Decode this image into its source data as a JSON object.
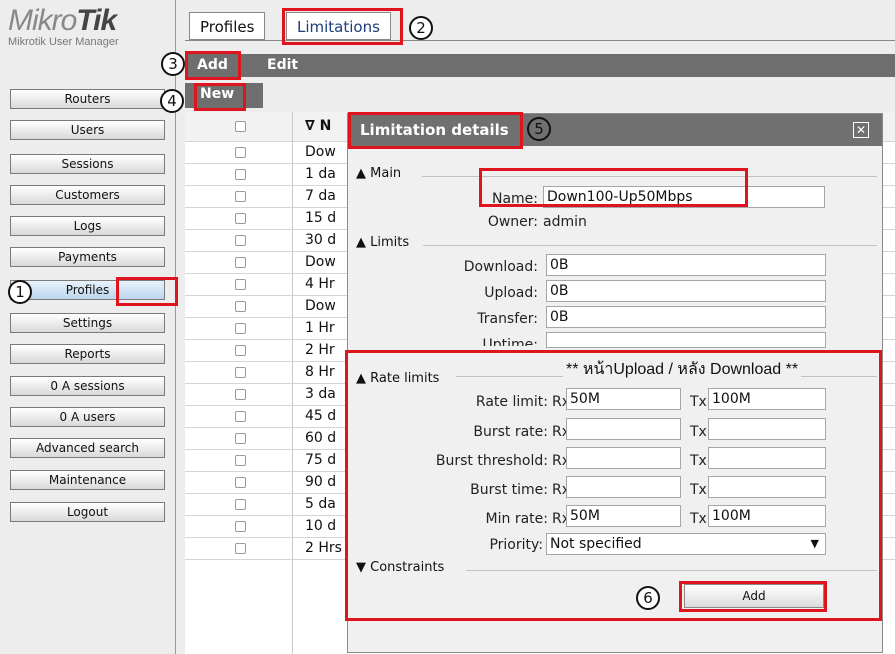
{
  "app": {
    "logo_brand_light": "Mikro",
    "logo_brand_bold": "Tik",
    "logo_sub": "Mikrotik User Manager"
  },
  "sidebar": {
    "items": [
      {
        "label": "Routers"
      },
      {
        "label": "Users"
      },
      {
        "label": "Sessions"
      },
      {
        "label": "Customers"
      },
      {
        "label": "Logs"
      },
      {
        "label": "Payments"
      },
      {
        "label": "Profiles"
      },
      {
        "label": "Settings"
      },
      {
        "label": "Reports"
      },
      {
        "label": "0 A sessions"
      },
      {
        "label": "0 A users"
      },
      {
        "label": "Advanced search"
      },
      {
        "label": "Maintenance"
      },
      {
        "label": "Logout"
      }
    ]
  },
  "tabs": [
    {
      "label": "Profiles"
    },
    {
      "label": "Limitations"
    }
  ],
  "toolbar": {
    "add_label": "Add",
    "edit_label": "Edit",
    "new_label": "New"
  },
  "table": {
    "header_name": "∇ N",
    "rows": [
      "Dow",
      "1 da",
      "7 da",
      "15 d",
      "30 d",
      "Dow",
      "4 Hr",
      "Dow",
      "1 Hr",
      "2 Hr",
      "8 Hr",
      "3 da",
      "45 d",
      "60 d",
      "75 d",
      "90 d",
      "5 da",
      "10 d",
      "2 Hrs"
    ]
  },
  "dialog": {
    "title": "Limitation details",
    "close_glyph": "✕",
    "main_section": "Main",
    "name_label": "Name:",
    "name_value": "Down100-Up50Mbps",
    "owner_label": "Owner:",
    "owner_value": "admin",
    "limits_section": "Limits",
    "download_label": "Download:",
    "download_value": "0B",
    "upload_label": "Upload:",
    "upload_value": "0B",
    "transfer_label": "Transfer:",
    "transfer_value": "0B",
    "uptime_label": "Uptime:",
    "rate_section": "Rate limits",
    "rate_note": "** หน้าUpload / หลัง Download **",
    "rate_limit_label": "Rate limit:",
    "rate_limit_rx": "50M",
    "rate_limit_tx": "100M",
    "burst_rate_label": "Burst rate:",
    "burst_threshold_label": "Burst threshold:",
    "burst_time_label": "Burst time:",
    "min_rate_label": "Min rate:",
    "min_rate_rx": "50M",
    "min_rate_tx": "100M",
    "rx_label": "Rx",
    "tx_label": "Tx",
    "priority_label": "Priority:",
    "priority_value": "Not specified",
    "constraints_section": "Constraints",
    "add_button": "Add"
  },
  "callouts": {
    "c1": "1",
    "c2": "2",
    "c3": "3",
    "c4": "4",
    "c5": "5",
    "c6": "6"
  },
  "colors": {
    "highlight": "#e0141e",
    "toolbar": "#6e6e6e"
  }
}
